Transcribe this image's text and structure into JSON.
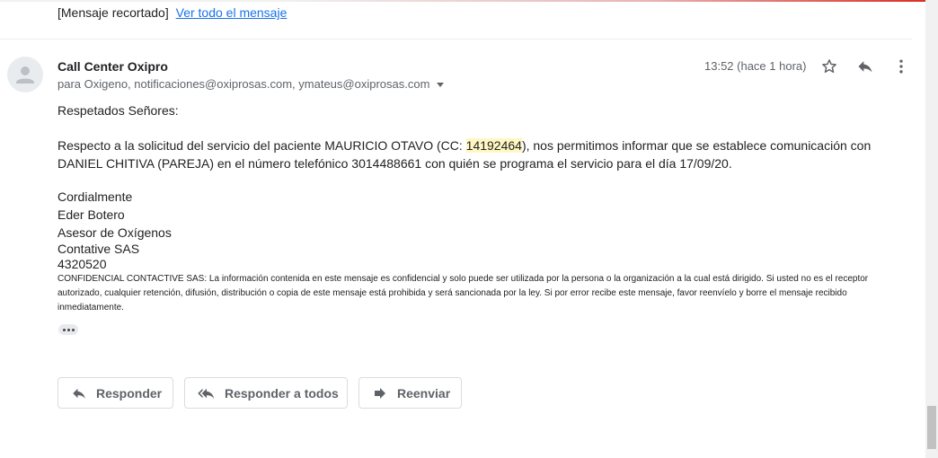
{
  "clipped_notice": {
    "text": "[Mensaje recortado]",
    "link": "Ver todo el mensaje"
  },
  "message": {
    "sender": "Call Center Oxipro",
    "recipients": "para Oxigeno, notificaciones@oxiprosas.com, ymateus@oxiprosas.com",
    "time": "13:52 (hace 1 hora)",
    "greeting": "Respetados Señores:",
    "body_part1": "Respecto a la solicitud del servicio del paciente MAURICIO OTAVO (CC: ",
    "body_highlight": "14192464",
    "body_part2": "), nos permitimos informar que se establece comunicación con DANIEL CHITIVA (PAREJA) en el número telefónico 3014488661 con quién se programa el servicio para el día 17/09/20.",
    "closing": "Cordialmente",
    "signature": [
      "Eder Botero",
      "Asesor de Oxígenos",
      "Contative SAS",
      "4320520"
    ],
    "legal": "CONFIDENCIAL CONTACTIVE SAS: La información contenida en este mensaje es confidencial y solo puede ser utilizada por la persona o la organización a la cual está dirigido. Si usted no es el receptor autorizado, cualquier retención, difusión, distribución o copia de este mensaje está prohibida y será sancionada por la ley. Si por error recibe este mensaje, favor reenvíelo y borre el mensaje recibido inmediatamente."
  },
  "actions": {
    "reply": "Responder",
    "reply_all": "Responder a todos",
    "forward": "Reenviar"
  },
  "icons": {
    "avatar": "person-icon",
    "star": "star-icon",
    "reply": "reply-icon",
    "more": "more-vert-icon",
    "reply_all": "reply-all-icon",
    "forward": "forward-icon"
  }
}
